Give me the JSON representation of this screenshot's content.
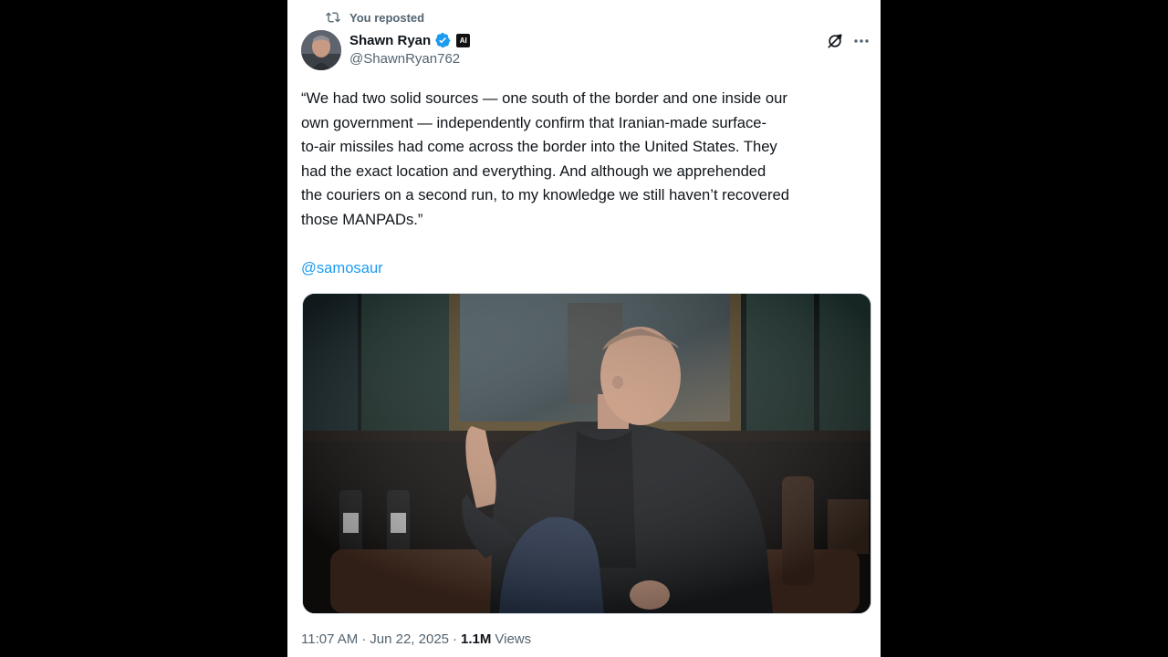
{
  "repost": {
    "label": "You reposted",
    "icon": "repost-icon"
  },
  "author": {
    "display_name": "Shawn Ryan",
    "handle": "@ShawnRyan762",
    "verified_color": "#1d9bf0",
    "affiliate_badge": "AI"
  },
  "actions": {
    "grok_icon": "grok-icon",
    "more_icon": "more-icon"
  },
  "tweet": {
    "text": "“We had two solid sources — one south of the border and one inside our\nown government — independently confirm that Iranian-made surface-\nto-air missiles had come across the border into the United States. They\nhad the exact location and everything. And although we apprehended\nthe couriers on a second run, to my knowledge we still haven’t recovered\nthose MANPADs.”",
    "mention": "@samosaur"
  },
  "meta": {
    "time": "11:07 AM",
    "separator1": "·",
    "date": "Jun 22, 2025",
    "separator2": "·",
    "views_count": "1.1M",
    "views_label": "Views"
  },
  "colors": {
    "text_primary": "#0f1419",
    "text_secondary": "#536471",
    "link": "#1d9bf0",
    "background": "#ffffff",
    "outer": "#000000"
  }
}
